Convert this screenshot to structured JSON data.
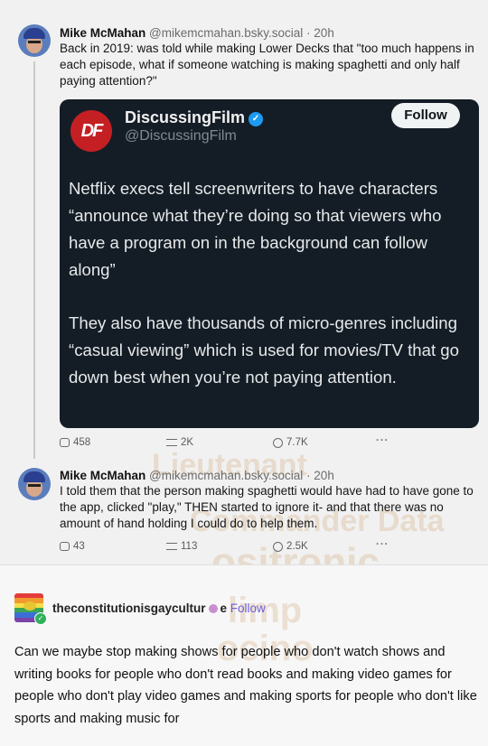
{
  "post1": {
    "name": "Mike McMahan",
    "handle": "@mikemcmahan.bsky.social · 20h",
    "text": "Back in 2019: was told while making Lower Decks that \"too much happens in each episode, what if someone watching is making spaghetti and only half paying attention?\""
  },
  "embed": {
    "logo": "DF",
    "name": "DiscussingFilm",
    "handle": "@DiscussingFilm",
    "follow_label": "Follow",
    "para1": "Netflix execs tell screenwriters to have characters “announce what they’re doing so that viewers who have a program on in the background can follow along”",
    "para2": "They also have thousands of micro-genres including “casual viewing” which is used for movies/TV that go down best when you’re not paying attention."
  },
  "post1_actions": {
    "replies": "458",
    "reposts": "2K",
    "likes": "7.7K",
    "more": "···"
  },
  "post2": {
    "name": "Mike McMahan",
    "handle": "@mikemcmahan.bsky.social · 20h",
    "text": "I told them that the person making spaghetti would have had to have gone to the app, clicked \"play,\" THEN started to ignore it- and that there was no amount of hand holding I could do to help them."
  },
  "post2_actions": {
    "replies": "43",
    "reposts": "113",
    "likes": "2.5K",
    "more": "···"
  },
  "watermark": {
    "l1": "Lieutenant",
    "l2": "Commander Data",
    "l3": "ositronic",
    "l4": "limp",
    "l5": "ocino"
  },
  "tumblr": {
    "username": "theconstitutionisgaycultur",
    "username_end": "e",
    "follow_label": "Follow",
    "text": "Can we maybe stop making shows for people who don't watch shows and writing books for people who don't read books and making video games for people who don't play video games and making sports for people who don't like sports and making music for"
  },
  "colors": {
    "embed_bg": "#141d26",
    "df_red": "#c42024",
    "verified": "#1d9bf0",
    "tumblr_follow": "#6e5bd8"
  }
}
